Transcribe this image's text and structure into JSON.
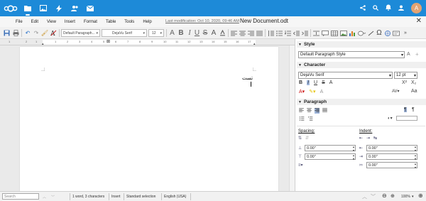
{
  "colors": {
    "header_bg": "#1d8ad8",
    "accent": "#1d8ad8",
    "avatar_bg": "#e1a373"
  },
  "header": {
    "apps": [
      {
        "name": "files-icon",
        "active": true
      },
      {
        "name": "photos-icon"
      },
      {
        "name": "activity-icon"
      },
      {
        "name": "contacts-icon"
      },
      {
        "name": "mail-icon"
      }
    ],
    "avatar_letter": "A"
  },
  "menubar": {
    "items": [
      "File",
      "Edit",
      "View",
      "Insert",
      "Format",
      "Table",
      "Tools",
      "Help"
    ],
    "last_modification": "Last modification: Oct 10, 2020, 09:46 AM",
    "document_title": "New Document.odt"
  },
  "toolbar": {
    "paragraph_style": "Default Paragraph...",
    "font_name": "DejaVu Serif",
    "font_size": "12",
    "bold": "B",
    "italic": "I",
    "underline": "U",
    "strikethrough": "S",
    "text_a": "A",
    "sigma": "Ω"
  },
  "ruler": {
    "numbers": [
      "1",
      "2",
      "1",
      "1",
      "2",
      "3",
      "4",
      "5",
      "6",
      "7",
      "8",
      "9",
      "10",
      "11",
      "12",
      "13",
      "14",
      "15",
      "16",
      "17"
    ]
  },
  "document": {
    "text": "تست"
  },
  "sidebar": {
    "style": {
      "title": "Style",
      "value": "Default Paragraph Style"
    },
    "character": {
      "title": "Character",
      "font": "DejaVu Serif",
      "size": "12 pt"
    },
    "paragraph": {
      "title": "Paragraph",
      "spacing_label": "Spacing:",
      "indent_label": "Indent:",
      "spacing_values": [
        "0.00\"",
        "0.00\""
      ],
      "indent_values": [
        "0.00\"",
        "0.00\"",
        "0.00\""
      ]
    }
  },
  "statusbar": {
    "search_placeholder": "Search",
    "word_count": "1 word, 3 characters",
    "insert_mode": "Insert",
    "selection_mode": "Standard selection",
    "language": "English (USA)",
    "zoom": "100%"
  }
}
